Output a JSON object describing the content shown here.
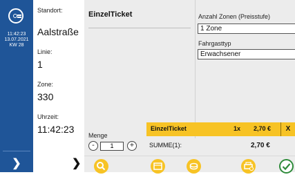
{
  "status": {
    "time": "11:42:23",
    "date": "13.07.2021",
    "week": "KW 28"
  },
  "info": {
    "standort_label": "Standort:",
    "standort_value": "Aalstraße",
    "linie_label": "Linie:",
    "linie_value": "1",
    "zone_label": "Zone:",
    "zone_value": "330",
    "uhrzeit_label": "Uhrzeit:",
    "uhrzeit_value": "11:42:23"
  },
  "ticket": {
    "title": "EinzelTicket"
  },
  "zones": {
    "label": "Anzahl Zonen (Preisstufe)",
    "selected": "1 Zone"
  },
  "fahrgasttyp": {
    "label": "Fahrgasttyp",
    "selected": "Erwachsener"
  },
  "menge": {
    "label": "Menge",
    "value": "1",
    "minus": "-",
    "plus": "+"
  },
  "basket": {
    "item_name": "EinzelTicket",
    "item_qty": "1x",
    "item_price": "2,70 €",
    "remove": "X",
    "sum_label": "SUMME(1):",
    "sum_value": "2,70 €"
  },
  "icons": {
    "logo": "operator-logo-icon",
    "nav_left": "chevron-right-icon",
    "nav_info": "chevron-right-icon",
    "actions": [
      "search-icon",
      "ticket-icon",
      "coin-icon",
      "print-icon",
      "check-icon"
    ]
  },
  "colors": {
    "navy": "#1f5598",
    "yellow": "#f7c325",
    "green": "#2e8b3a"
  }
}
